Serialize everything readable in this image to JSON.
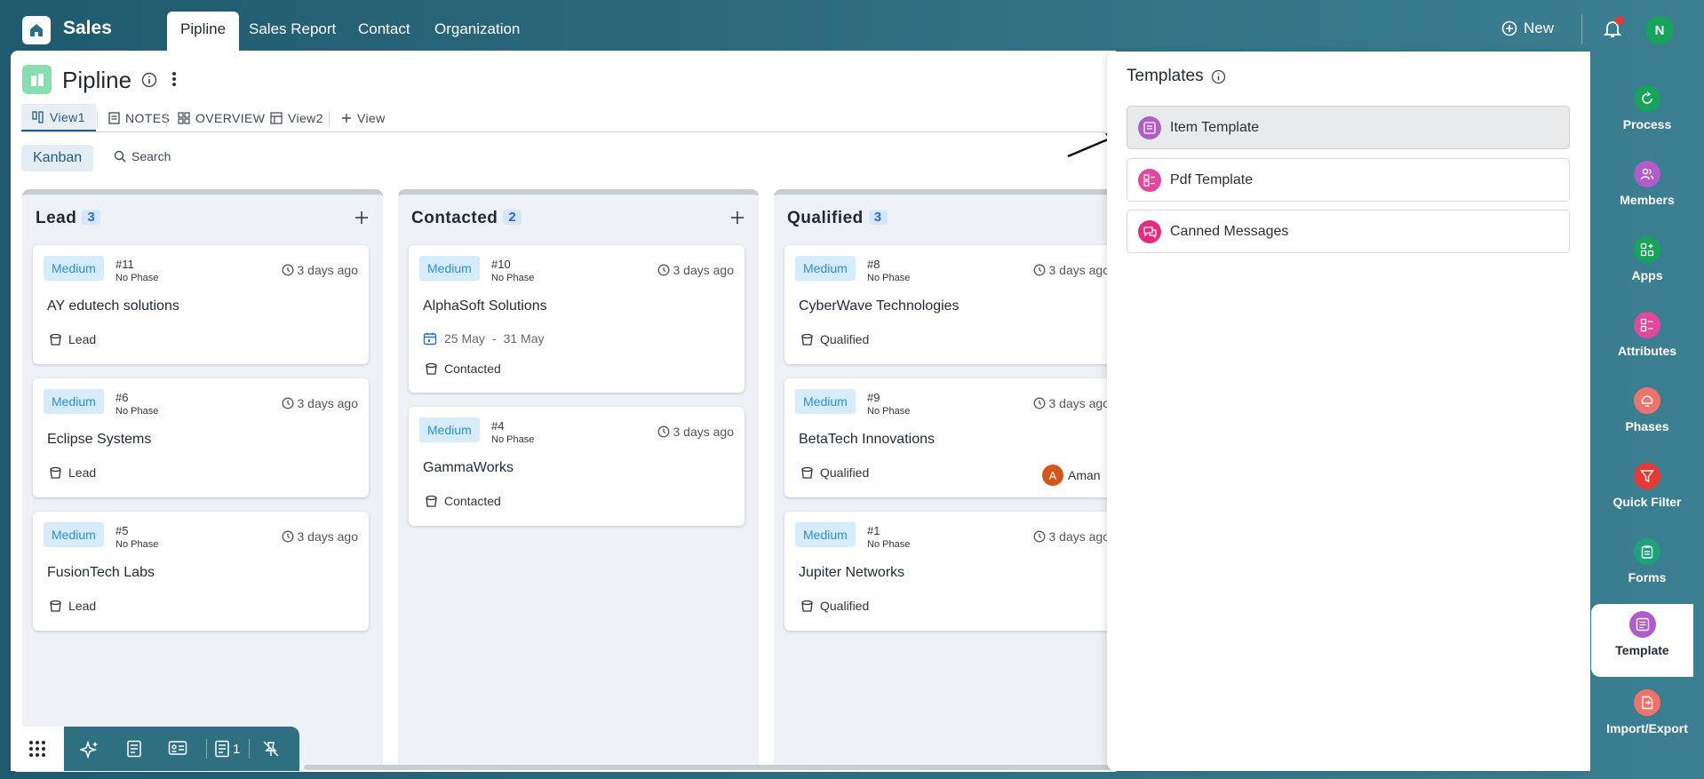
{
  "app": {
    "title": "Sales"
  },
  "nav": {
    "tabs": [
      "Pipline",
      "Sales Report",
      "Contact",
      "Organization"
    ],
    "new_label": "New",
    "user_initial": "N"
  },
  "page": {
    "title": "Pipline"
  },
  "views": {
    "tabs": [
      "View1",
      "NOTES",
      "OVERVIEW",
      "View2"
    ],
    "add_label": "View"
  },
  "toolbar": {
    "kanban_label": "Kanban",
    "search_label": "Search"
  },
  "columns": [
    {
      "title": "Lead",
      "count": "3",
      "cards": [
        {
          "priority": "Medium",
          "number": "#11",
          "phase": "No Phase",
          "time": "3 days ago",
          "name": "AY edutech solutions",
          "stage": "Lead"
        },
        {
          "priority": "Medium",
          "number": "#6",
          "phase": "No Phase",
          "time": "3 days ago",
          "name": "Eclipse Systems",
          "stage": "Lead"
        },
        {
          "priority": "Medium",
          "number": "#5",
          "phase": "No Phase",
          "time": "3 days ago",
          "name": "FusionTech Labs",
          "stage": "Lead"
        }
      ]
    },
    {
      "title": "Contacted",
      "count": "2",
      "cards": [
        {
          "priority": "Medium",
          "number": "#10",
          "phase": "No Phase",
          "time": "3 days ago",
          "name": "AlphaSoft Solutions",
          "date_start": "25 May",
          "date_sep": "-",
          "date_end": "31 May",
          "stage": "Contacted"
        },
        {
          "priority": "Medium",
          "number": "#4",
          "phase": "No Phase",
          "time": "3 days ago",
          "name": "GammaWorks",
          "stage": "Contacted"
        }
      ]
    },
    {
      "title": "Qualified",
      "count": "3",
      "cards": [
        {
          "priority": "Medium",
          "number": "#8",
          "phase": "No Phase",
          "time": "3 days ago",
          "name": "CyberWave Technologies",
          "stage": "Qualified"
        },
        {
          "priority": "Medium",
          "number": "#9",
          "phase": "No Phase",
          "time": "3 days ago",
          "name": "BetaTech Innovations",
          "stage": "Qualified",
          "assignee_initial": "A",
          "assignee_name": "Aman"
        },
        {
          "priority": "Medium",
          "number": "#1",
          "phase": "No Phase",
          "time": "3 days ago",
          "name": "Jupiter Networks",
          "stage": "Qualified"
        }
      ]
    }
  ],
  "bottombar": {
    "notes_count": "1"
  },
  "templates": {
    "title": "Templates",
    "items": [
      "Item Template",
      "Pdf Template",
      "Canned Messages"
    ],
    "selected": "Item Template"
  },
  "rail": {
    "items": [
      "Process",
      "Members",
      "Apps",
      "Attributes",
      "Phases",
      "Quick Filter",
      "Forms",
      "Template",
      "Import/Export"
    ],
    "active": "Template"
  },
  "colors": {
    "accent": "#1f5a8a",
    "brand_bg": "#2f6f82",
    "badge_bg": "#d6ecfa",
    "badge_text": "#2b8fd6",
    "active_rail": "#b15cc9"
  }
}
